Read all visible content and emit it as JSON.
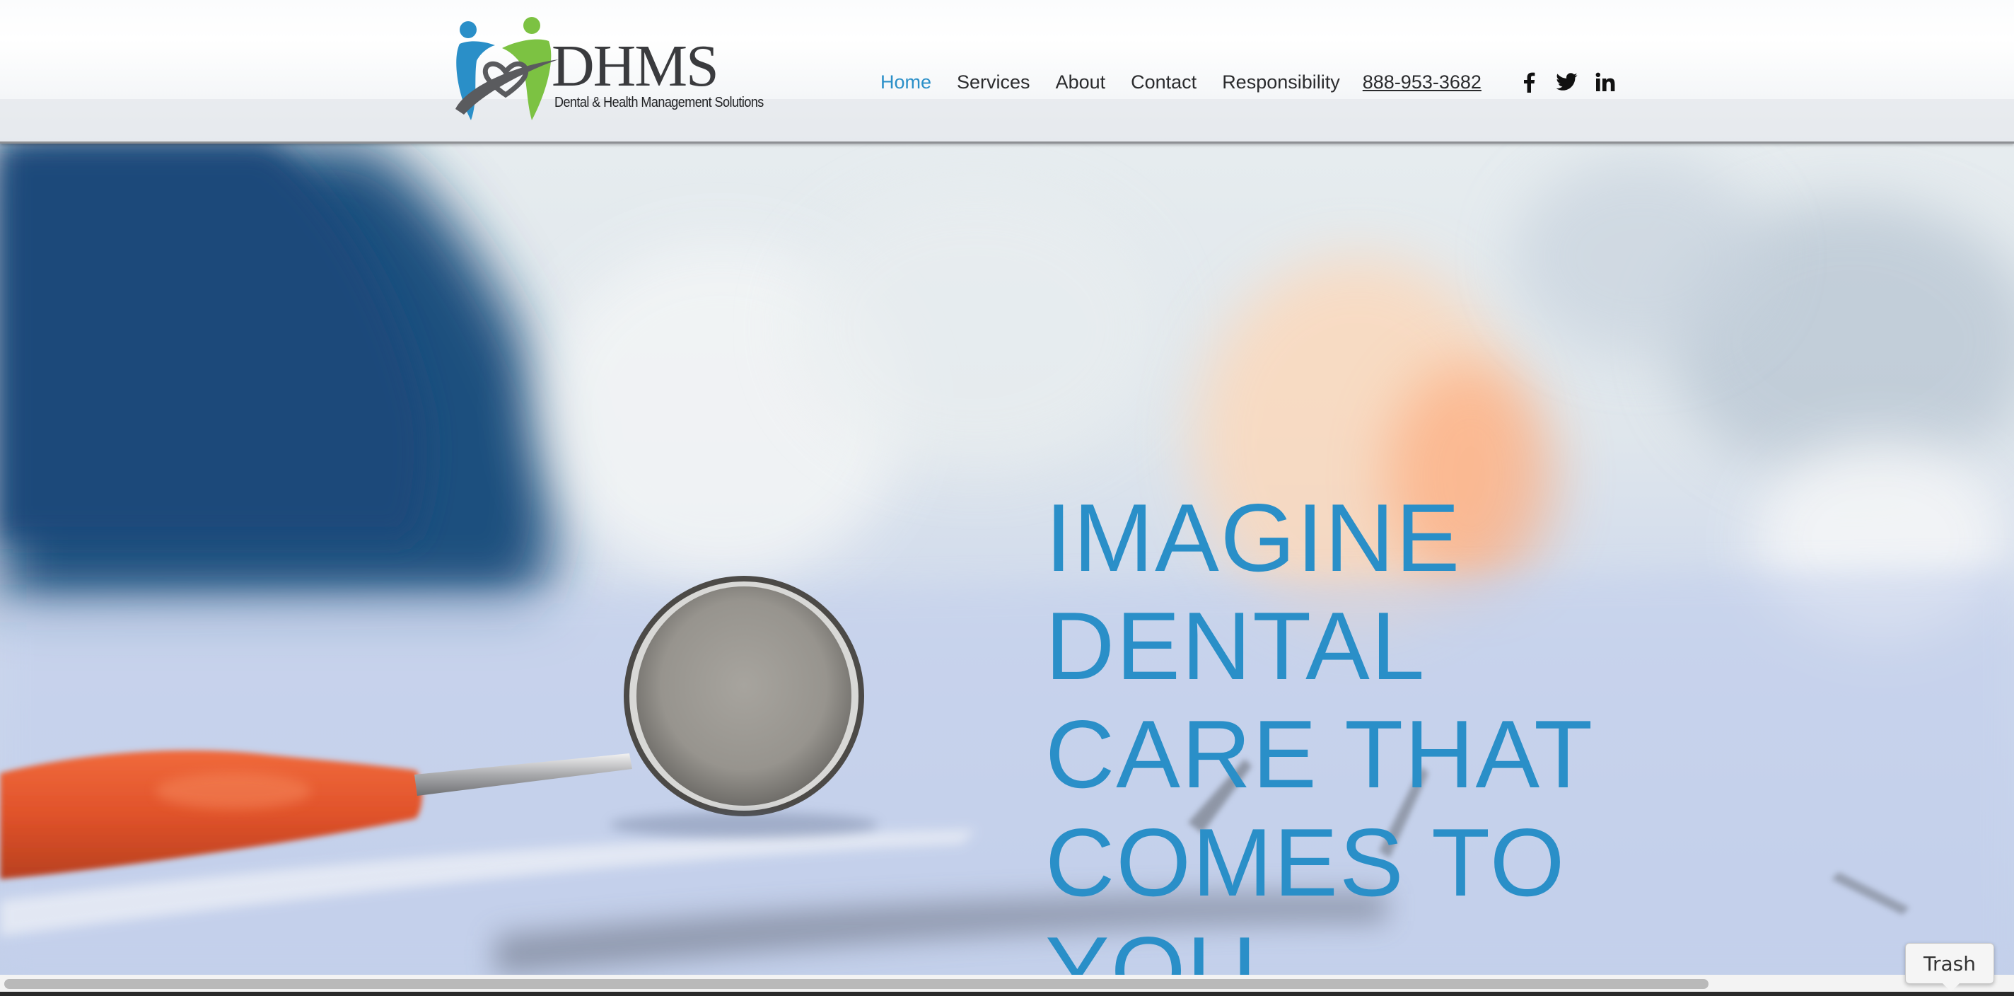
{
  "header": {
    "logo": {
      "wordmark": "DHMS",
      "tagline": "Dental & Health Management Solutions"
    },
    "nav": {
      "items": [
        {
          "label": "Home",
          "active": true
        },
        {
          "label": "Services",
          "active": false
        },
        {
          "label": "About",
          "active": false
        },
        {
          "label": "Contact",
          "active": false
        },
        {
          "label": "Responsibility",
          "active": false
        }
      ],
      "phone": "888-953-3682"
    },
    "social": [
      {
        "icon": "facebook-icon"
      },
      {
        "icon": "twitter-icon"
      },
      {
        "icon": "linkedin-icon"
      }
    ]
  },
  "hero": {
    "headline_lines": [
      "IMAGINE",
      "DENTAL",
      "CARE THAT",
      "COMES TO",
      "YOU"
    ],
    "image": "dental-mirror-photo"
  },
  "dock": {
    "trash_label": "Trash"
  },
  "colors": {
    "accent": "#2a8fc8",
    "text": "#2a2b2d",
    "logo_blue": "#2a8fc8",
    "logo_green": "#7cc242",
    "logo_gray": "#5a5b5e"
  }
}
